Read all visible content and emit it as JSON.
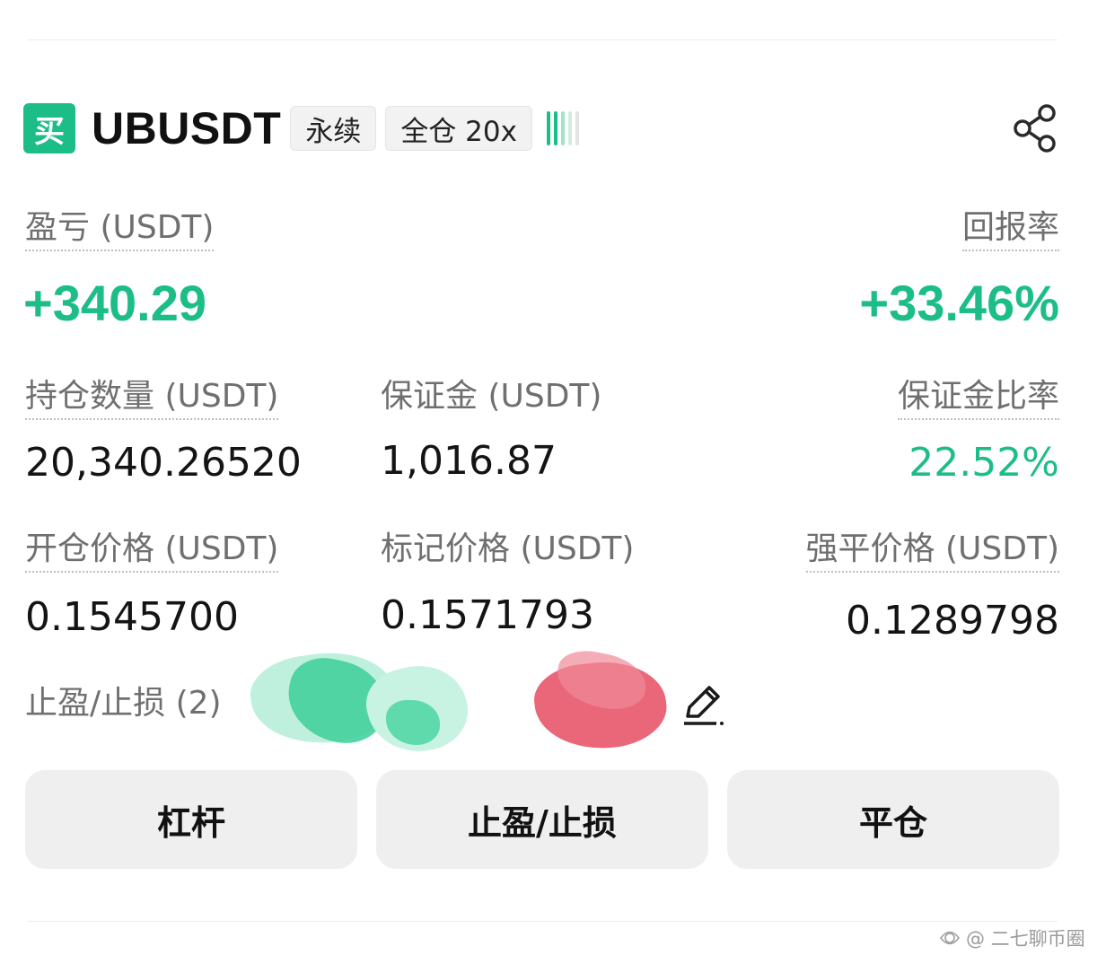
{
  "position": {
    "side_label": "买",
    "symbol": "UBUSDT",
    "contract_type": "永续",
    "margin_mode": "全仓 20x"
  },
  "metrics": {
    "pnl_label": "盈亏 (USDT)",
    "pnl_value": "+340.29",
    "roi_label": "回报率",
    "roi_value": "+33.46%",
    "size_label": "持仓数量 (USDT)",
    "size_value": "20,340.26520",
    "margin_label": "保证金 (USDT)",
    "margin_value": "1,016.87",
    "margin_ratio_label": "保证金比率",
    "margin_ratio_value": "22.52%",
    "entry_price_label": "开仓价格 (USDT)",
    "entry_price_value": "0.1545700",
    "mark_price_label": "标记价格 (USDT)",
    "mark_price_value": "0.1571793",
    "liq_price_label": "强平价格 (USDT)",
    "liq_price_value": "0.1289798",
    "tpsl_label": "止盈/止损 (2)"
  },
  "actions": {
    "leverage": "杠杆",
    "tpsl": "止盈/止损",
    "close": "平仓"
  },
  "watermark": {
    "text": "@ 二七聊币圈"
  },
  "colors": {
    "accent_green": "#1dbd87",
    "redaction_red": "#e8566a",
    "redaction_green": "#3ccf9a"
  },
  "icons": [
    "buy-badge",
    "signal-strength-icon",
    "share-icon",
    "edit-pencil-icon"
  ]
}
